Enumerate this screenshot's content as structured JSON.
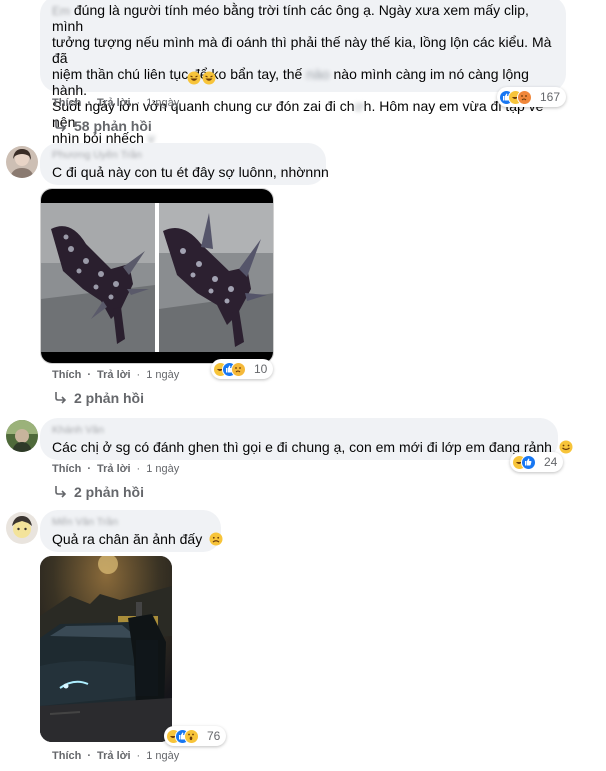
{
  "comments": [
    {
      "name": "Em",
      "lines": [
        "đúng là người tính méo bằng trời tính các ông ạ. Ngày xưa xem mấy clip, mình",
        "tưởng tượng nếu mình mà đi oánh thì phải thế này thế kia, lồng lộn các kiểu. Mà đã",
        "niệm thần chú liên tục để ko bẩn tay, thế",
        "nào mình càng im nó càng lộng hành.",
        "Suốt ngày lởn vởn quanh chung cư đón zai đi ch",
        "h. Hôm nay em vừa đi tập về nên",
        "nhìn bỏi nhếch"
      ],
      "like": "Thích",
      "reply": "Trả lời",
      "time": "1 ngày",
      "reactions": "167",
      "replies": "58 phản hồi"
    },
    {
      "name": "Phương Uyên Trần",
      "text": "C đi quả này con tu ét đây sợ luônn, nhờnnn",
      "like": "Thích",
      "reply": "Trả lời",
      "time": "1 ngày",
      "reactions": "10",
      "replies": "2 phản hồi"
    },
    {
      "name": "Khánh Vân",
      "text": "Các chị ở sg có đánh ghen thì gọi e đi chung ạ, con em mới đi lớp em đang rảnh",
      "like": "Thích",
      "reply": "Trả lời",
      "time": "1 ngày",
      "reactions": "24",
      "replies": "2 phản hồi"
    },
    {
      "name": "Mến Vân Trần",
      "text": "Quả ra chân ăn ảnh đấy",
      "like": "Thích",
      "reply": "Trả lời",
      "time": "1 ngày",
      "reactions": "76"
    }
  ],
  "colors": {
    "bubble": "#f0f2f5",
    "meta": "#65676b",
    "like": "#1877f2",
    "haha": "#f7c43a"
  }
}
